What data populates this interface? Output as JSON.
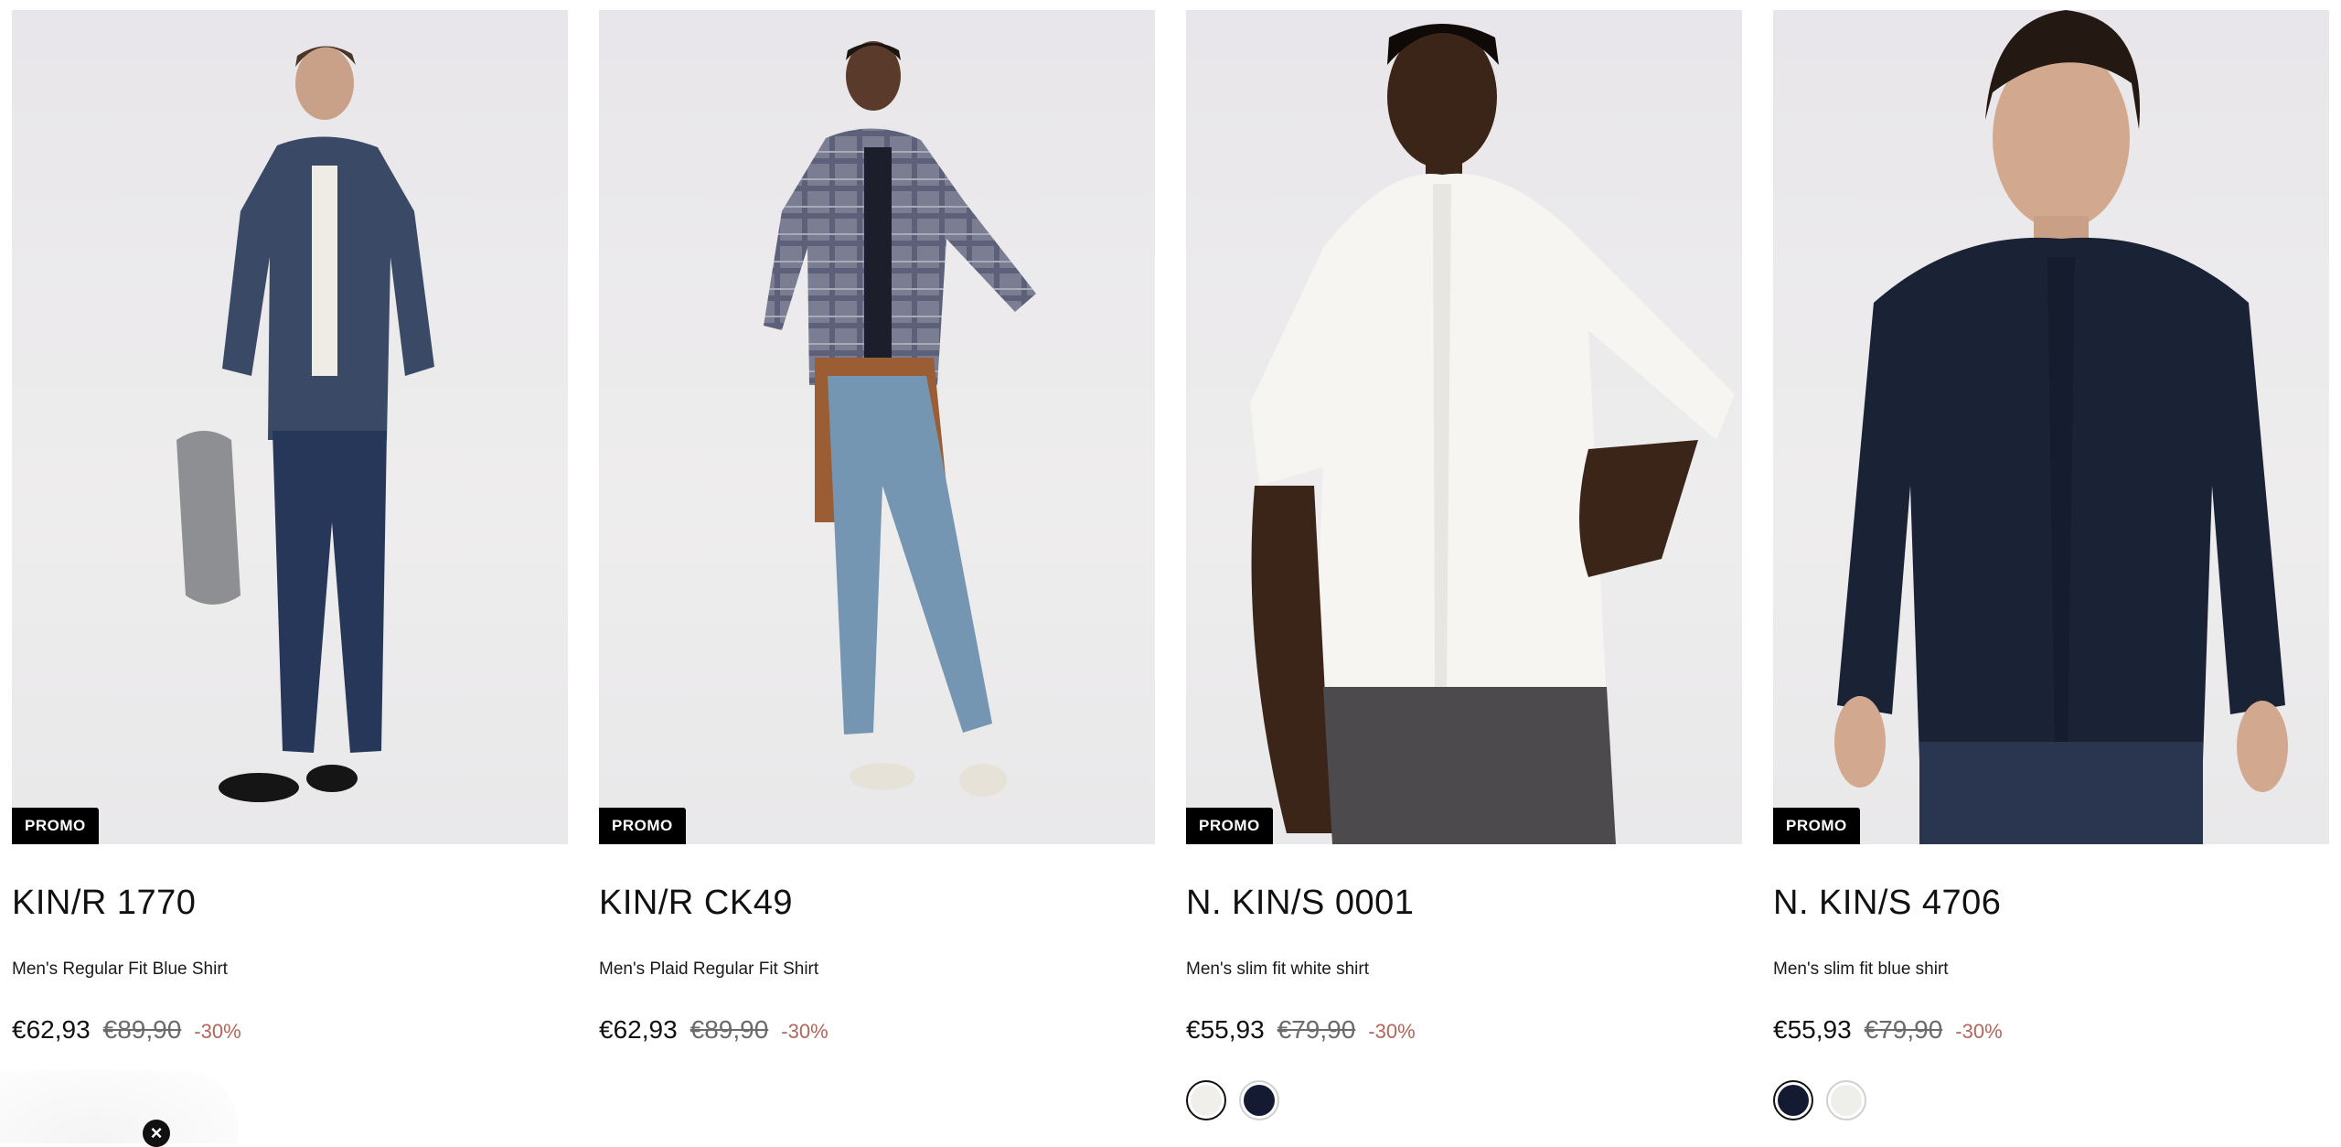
{
  "products": [
    {
      "badge": "PROMO",
      "name": "KIN/R 1770",
      "description": "Men's Regular Fit Blue Shirt",
      "price": "€62,93",
      "old_price": "€89,90",
      "discount": "-30%",
      "image": "man in navy regular fit shirt and jeans",
      "swatches": []
    },
    {
      "badge": "PROMO",
      "name": "KIN/R CK49",
      "description": "Men's Plaid Regular Fit Shirt",
      "price": "€62,93",
      "old_price": "€89,90",
      "discount": "-30%",
      "image": "man in plaid shirt and light jeans",
      "swatches": []
    },
    {
      "badge": "PROMO",
      "name": "N. KIN/S 0001",
      "description": "Men's slim fit white shirt",
      "price": "€55,93",
      "old_price": "€79,90",
      "discount": "-30%",
      "image": "man in white slim fit shirt",
      "swatches": [
        {
          "color": "#f1efe9",
          "selected": true
        },
        {
          "color": "#151a33",
          "selected": false
        }
      ]
    },
    {
      "badge": "PROMO",
      "name": "N. KIN/S 4706",
      "description": "Men's slim fit blue shirt",
      "price": "€55,93",
      "old_price": "€79,90",
      "discount": "-30%",
      "image": "man in navy slim fit shirt",
      "swatches": [
        {
          "color": "#151a33",
          "selected": true
        },
        {
          "color": "#eeeeea",
          "selected": false
        }
      ]
    }
  ],
  "popup": {
    "close_icon": "close-icon"
  },
  "colors": {
    "badge_bg": "#000000",
    "discount": "#b0665a",
    "old_price": "#6b6b6b"
  }
}
